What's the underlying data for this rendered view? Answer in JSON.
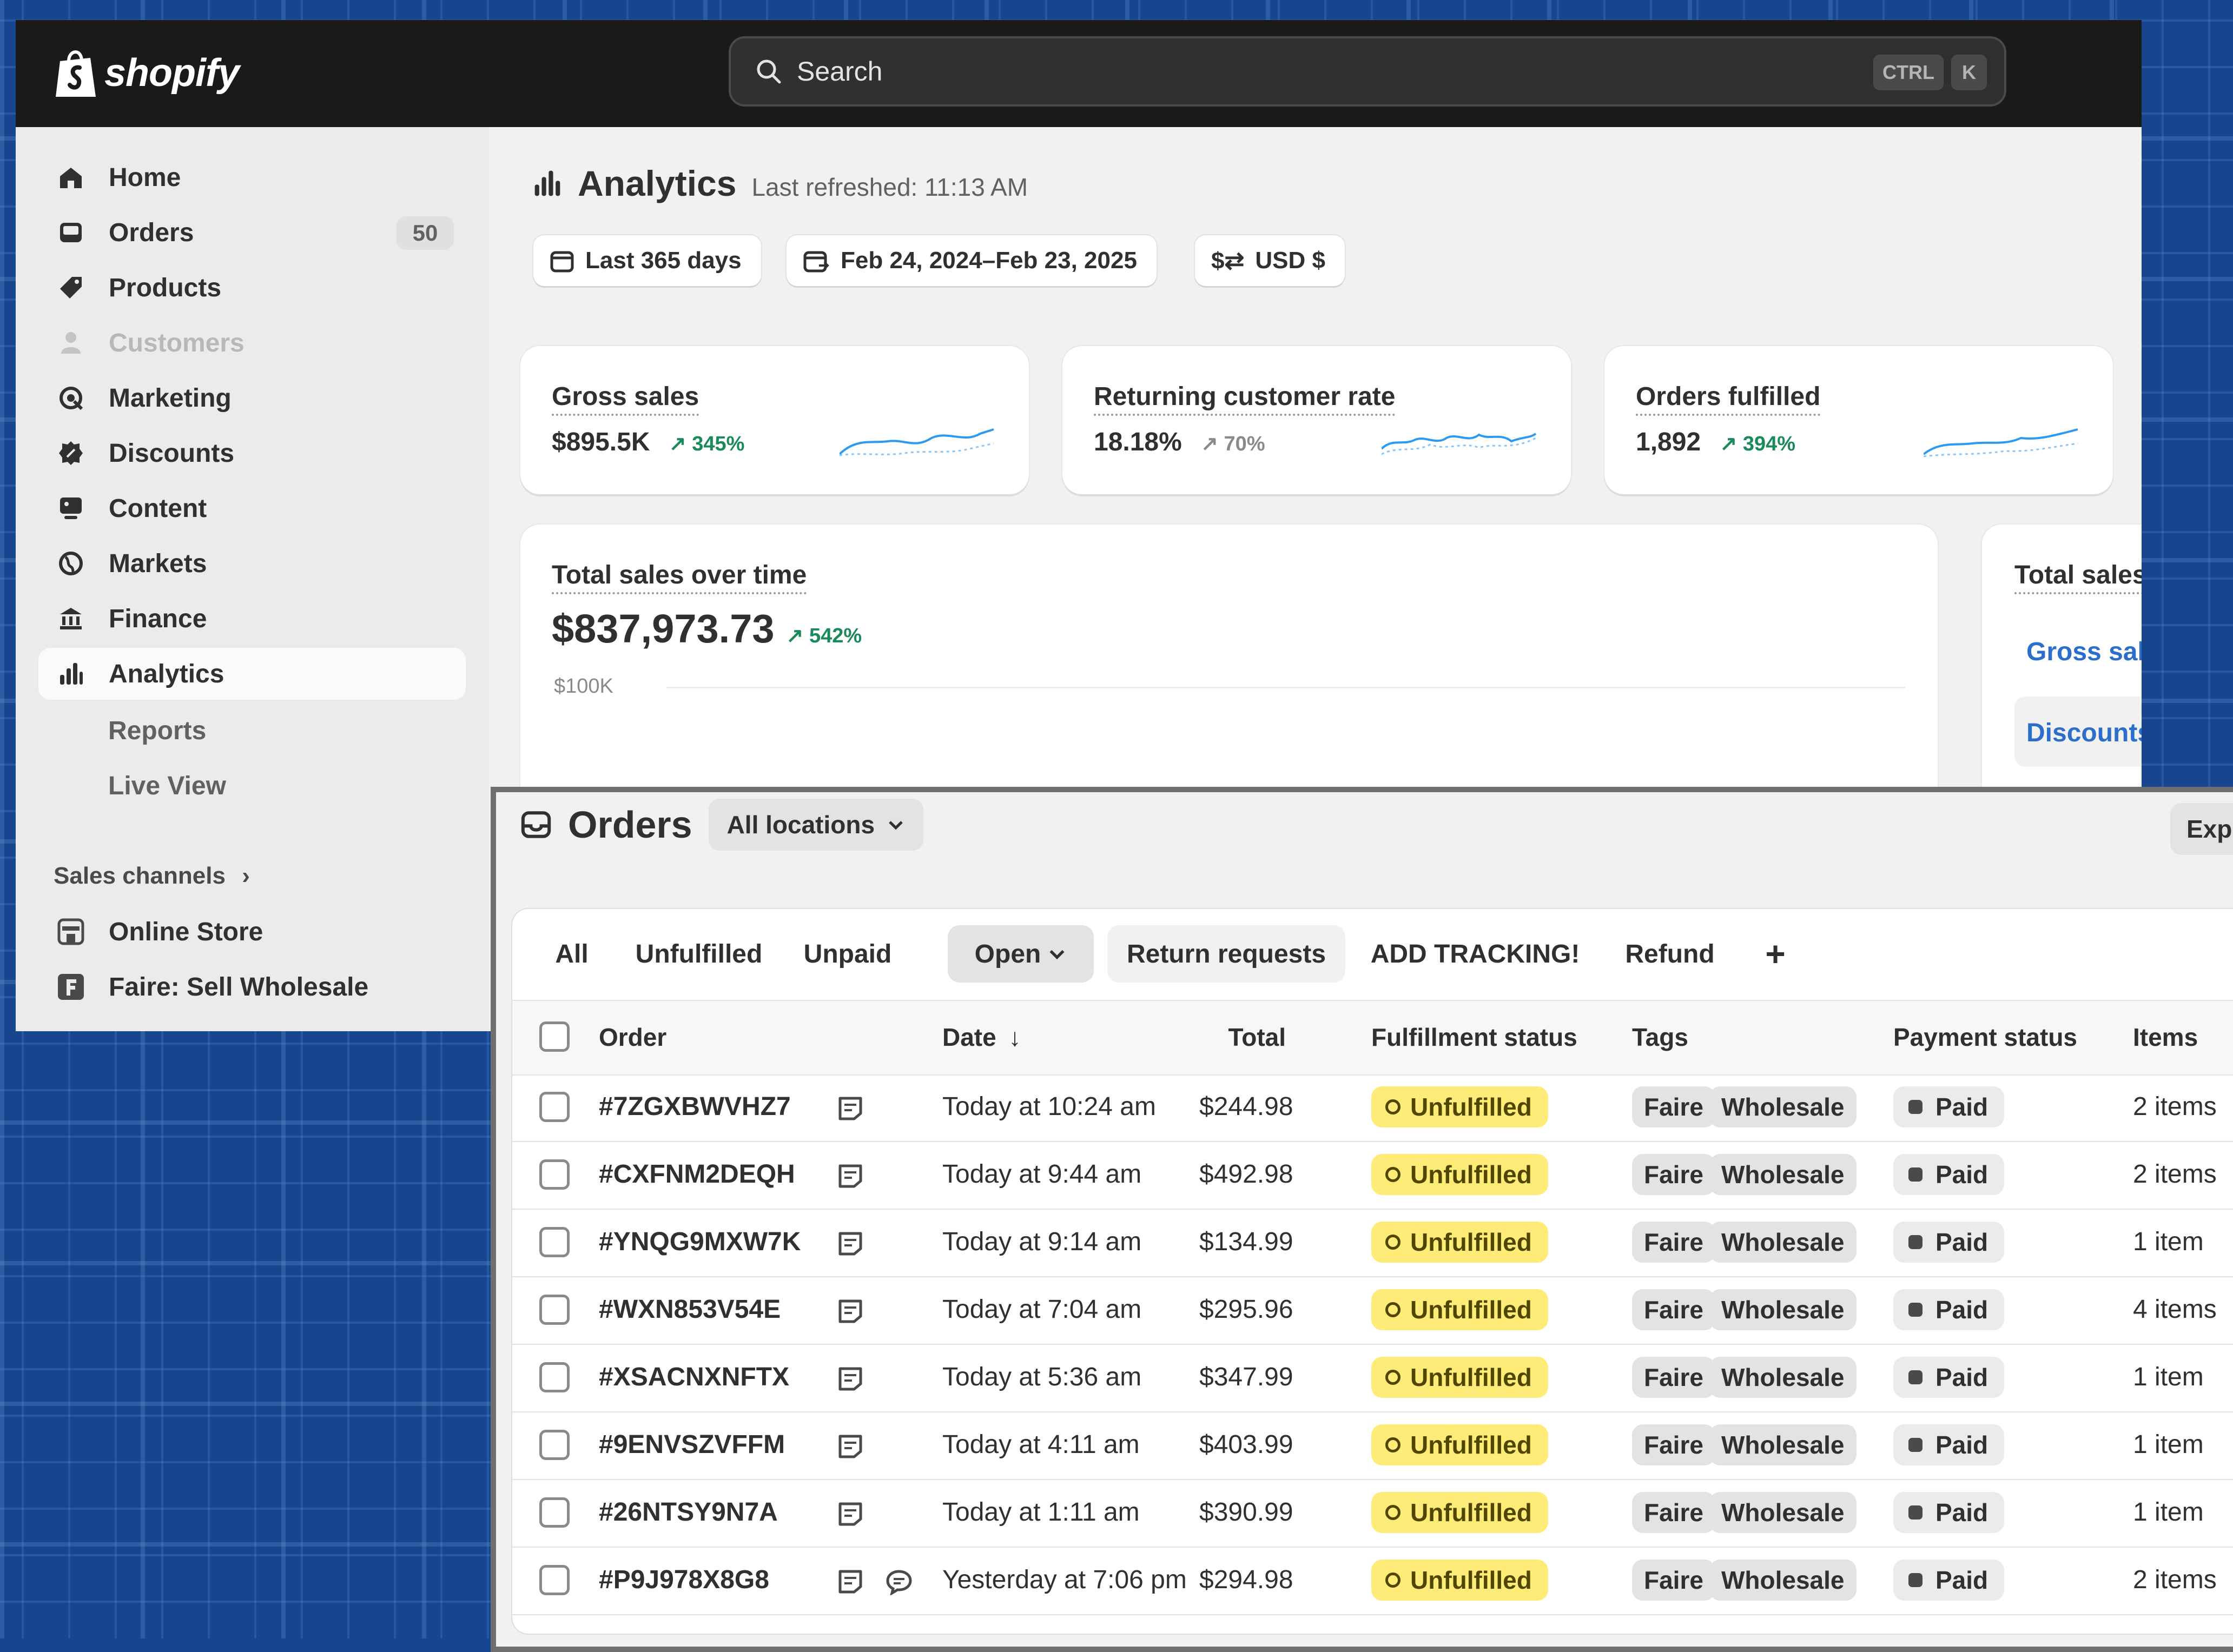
{
  "brand": {
    "name": "shopify"
  },
  "search": {
    "label": "Search",
    "kbd1": "CTRL",
    "kbd2": "K"
  },
  "sidebar": {
    "items": [
      {
        "label": "Home",
        "icon": "home-icon"
      },
      {
        "label": "Orders",
        "icon": "inbox-icon",
        "badge": "50"
      },
      {
        "label": "Products",
        "icon": "tag-icon"
      },
      {
        "label": "Customers",
        "icon": "person-icon"
      },
      {
        "label": "Marketing",
        "icon": "target-icon"
      },
      {
        "label": "Discounts",
        "icon": "discount-icon"
      },
      {
        "label": "Content",
        "icon": "content-icon"
      },
      {
        "label": "Markets",
        "icon": "globe-icon"
      },
      {
        "label": "Finance",
        "icon": "bank-icon"
      },
      {
        "label": "Analytics",
        "icon": "bar-chart-icon"
      }
    ],
    "subitems": [
      "Reports",
      "Live View"
    ],
    "sales_channels_label": "Sales channels",
    "channels": [
      {
        "label": "Online Store",
        "icon": "store-icon"
      },
      {
        "label": "Faire: Sell Wholesale",
        "icon": "faire-app-icon"
      }
    ]
  },
  "analytics": {
    "title": "Analytics",
    "refreshed": "Last refreshed: 11:13 AM",
    "filters": [
      "Last 365 days",
      "Feb 24, 2024–Feb 23, 2025",
      "USD $"
    ],
    "metrics": [
      {
        "label": "Gross sales",
        "value": "$895.5K",
        "delta": "345%"
      },
      {
        "label": "Returning customer rate",
        "value": "18.18%",
        "delta": "70%"
      },
      {
        "label": "Orders fulfilled",
        "value": "1,892",
        "delta": "394%"
      }
    ],
    "total_sales": {
      "label": "Total sales over time",
      "value": "$837,973.73",
      "delta": "542%",
      "y_tick": "$100K"
    },
    "breakdown": {
      "label": "Total sales b",
      "rows": [
        "Gross sales",
        "Discounts"
      ]
    },
    "colors": {
      "accent": "#2b9af3",
      "positive": "#1b8a5a"
    }
  },
  "orders": {
    "title": "Orders",
    "location": "All locations",
    "export": "Exp",
    "tabs": [
      "All",
      "Unfulfilled",
      "Unpaid",
      "Open",
      "Return requests",
      "ADD TRACKING!",
      "Refund",
      "+"
    ],
    "columns": [
      "Order",
      "Date",
      "Total",
      "Fulfillment status",
      "Tags",
      "Payment status",
      "Items"
    ],
    "rows": [
      {
        "order": "#7ZGXBWVHZ7",
        "date": "Today at 10:24 am",
        "total": "$244.98",
        "fulfillment": "Unfulfilled",
        "tag1": "Faire",
        "tag2": "Wholesale",
        "payment": "Paid",
        "items": "2 items"
      },
      {
        "order": "#CXFNM2DEQH",
        "date": "Today at 9:44 am",
        "total": "$492.98",
        "fulfillment": "Unfulfilled",
        "tag1": "Faire",
        "tag2": "Wholesale",
        "payment": "Paid",
        "items": "2 items"
      },
      {
        "order": "#YNQG9MXW7K",
        "date": "Today at 9:14 am",
        "total": "$134.99",
        "fulfillment": "Unfulfilled",
        "tag1": "Faire",
        "tag2": "Wholesale",
        "payment": "Paid",
        "items": "1 item"
      },
      {
        "order": "#WXN853V54E",
        "date": "Today at 7:04 am",
        "total": "$295.96",
        "fulfillment": "Unfulfilled",
        "tag1": "Faire",
        "tag2": "Wholesale",
        "payment": "Paid",
        "items": "4 items"
      },
      {
        "order": "#XSACNXNFTX",
        "date": "Today at 5:36 am",
        "total": "$347.99",
        "fulfillment": "Unfulfilled",
        "tag1": "Faire",
        "tag2": "Wholesale",
        "payment": "Paid",
        "items": "1 item"
      },
      {
        "order": "#9ENVSZVFFM",
        "date": "Today at 4:11 am",
        "total": "$403.99",
        "fulfillment": "Unfulfilled",
        "tag1": "Faire",
        "tag2": "Wholesale",
        "payment": "Paid",
        "items": "1 item"
      },
      {
        "order": "#26NTSY9N7A",
        "date": "Today at 1:11 am",
        "total": "$390.99",
        "fulfillment": "Unfulfilled",
        "tag1": "Faire",
        "tag2": "Wholesale",
        "payment": "Paid",
        "items": "1 item"
      },
      {
        "order": "#P9J978X8G8",
        "date": "Yesterday at 7:06 pm",
        "total": "$294.98",
        "fulfillment": "Unfulfilled",
        "tag1": "Faire",
        "tag2": "Wholesale",
        "payment": "Paid",
        "items": "2 items",
        "chat": true
      }
    ],
    "colors": {
      "unfulfilled": "#ffeb78",
      "tag": "#e3e3e3"
    }
  }
}
